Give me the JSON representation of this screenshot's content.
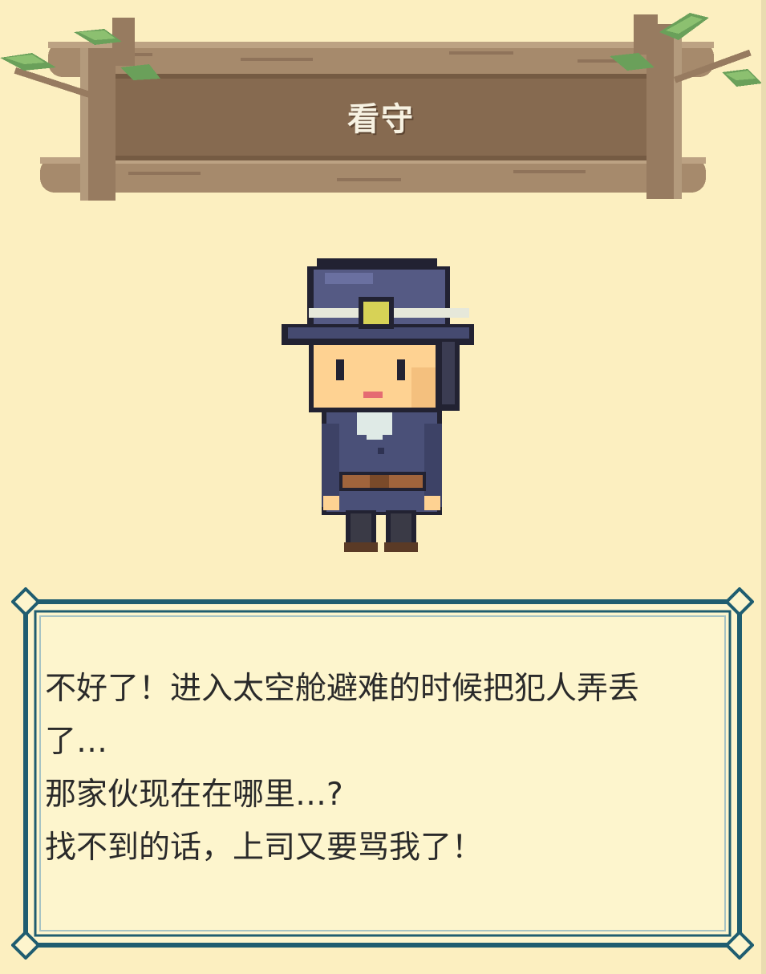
{
  "sign": {
    "title": "看守"
  },
  "character": {
    "name": "guard"
  },
  "dialog": {
    "lines": [
      "不好了！进入太空舱避难的时候把犯人弄丢",
      "了…",
      "那家伙现在在哪里…?",
      "找不到的话，上司又要骂我了！"
    ]
  },
  "colors": {
    "background": "#fcefc0",
    "wood_dark": "#866a50",
    "wood_light": "#a68a6c",
    "frame_blue": "#1f5d70",
    "dialog_fill": "#fdf5cd",
    "leaf_green": "#6aa05a"
  }
}
